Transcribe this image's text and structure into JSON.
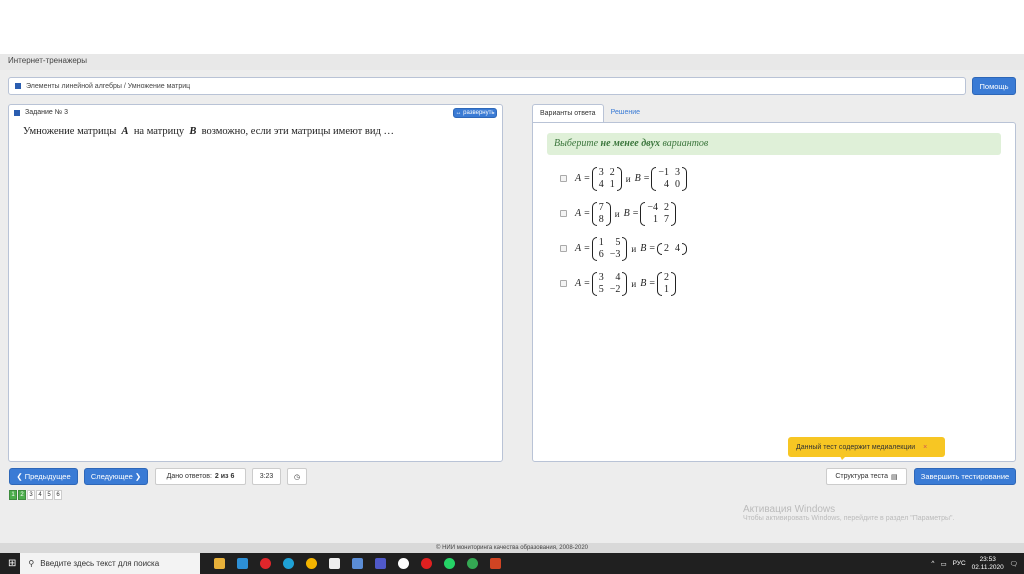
{
  "app": {
    "title": "Интернет-тренажеры"
  },
  "breadcrumb": "Элементы линейной алгебры / Умножение матриц",
  "help_button": "Помощь",
  "task": {
    "title": "Задание № 3",
    "expand": "↔ развернуть",
    "question_pre": "Умножение матрицы",
    "var_a": "A",
    "question_mid": "на матрицу",
    "var_b": "B",
    "question_post": "возможно, если эти матрицы имеют вид …"
  },
  "tabs": [
    {
      "label": "Варианты ответа"
    },
    {
      "label": "Решение"
    }
  ],
  "hint": {
    "pre": "Выберите",
    "bold": "не менее двух",
    "post": "вариантов"
  },
  "options": [
    {
      "a": [
        [
          "3",
          "2"
        ],
        [
          "4",
          "1"
        ]
      ],
      "b": [
        [
          "−1",
          "3"
        ],
        [
          "4",
          "0"
        ]
      ]
    },
    {
      "a": [
        [
          "7"
        ],
        [
          "8"
        ]
      ],
      "b": [
        [
          "−4",
          "2"
        ],
        [
          "1",
          "7"
        ]
      ]
    },
    {
      "a": [
        [
          "1",
          "5"
        ],
        [
          "6",
          "−3"
        ]
      ],
      "b": [
        [
          "2",
          "4"
        ]
      ]
    },
    {
      "a": [
        [
          "3",
          "4"
        ],
        [
          "5",
          "−2"
        ]
      ],
      "b": [
        [
          "2"
        ],
        [
          "1"
        ]
      ]
    }
  ],
  "option_labels": {
    "a": "A",
    "b": "B",
    "eq": "=",
    "and": "и"
  },
  "nav": {
    "prev": "❮ Предыдущее",
    "next": "Следующее ❯",
    "answered_label": "Дано ответов:",
    "answered_value": "2 из 6",
    "timer": "3:23",
    "structure": "Структура теста",
    "finish": "Завершить тестирование"
  },
  "pages": [
    {
      "n": "1",
      "done": true
    },
    {
      "n": "2",
      "done": true
    },
    {
      "n": "3",
      "done": false
    },
    {
      "n": "4",
      "done": false
    },
    {
      "n": "5",
      "done": false
    },
    {
      "n": "6",
      "done": false
    }
  ],
  "toast": {
    "text": "Данный тест содержит медиалекции",
    "close": "×"
  },
  "watermark": {
    "title": "Активация Windows",
    "text": "Чтобы активировать Windows, перейдите в раздел \"Параметры\"."
  },
  "footer": "© НИИ мониторинга качества образования, 2008-2020",
  "taskbar": {
    "search_placeholder": "Введите здесь текст для поиска",
    "lang": "РУС",
    "time": "23:53",
    "date": "02.11.2020"
  }
}
